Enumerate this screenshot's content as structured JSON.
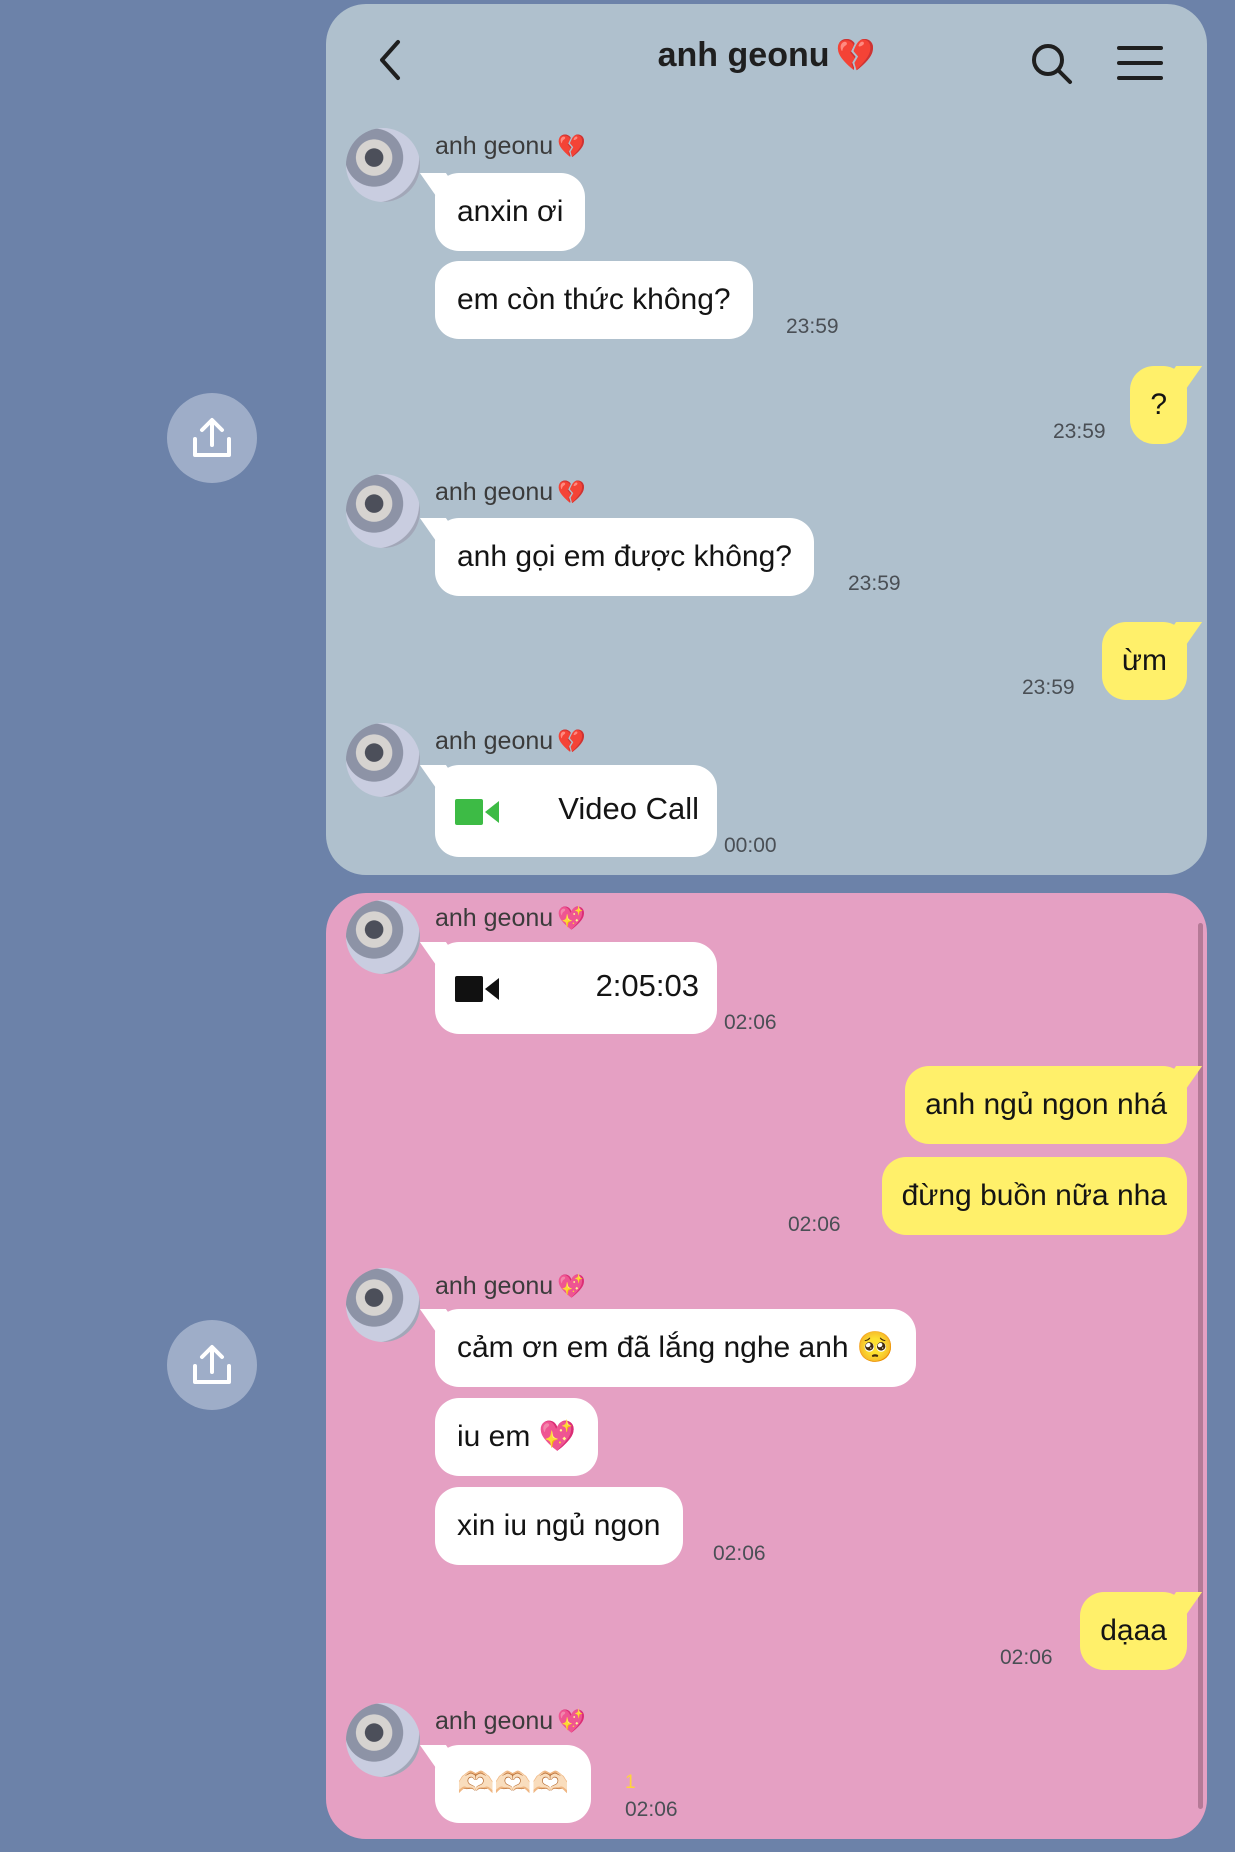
{
  "chat": {
    "title": "anh geonu",
    "title_emoji": "💔",
    "contact_name": "anh geonu",
    "heart_broken": "💔",
    "heart_sparkle": "💖"
  },
  "icons": {
    "back": "chevron-left-icon",
    "search": "search-icon",
    "menu": "hamburger-menu-icon",
    "share": "share-upload-icon",
    "video": "video-camera-icon"
  },
  "colors": {
    "page_bg": "#6c82a9",
    "panel_blue": "#afc0cd",
    "panel_pink": "#e5a0c3",
    "outgoing_bubble": "#fff06a",
    "incoming_bubble": "#ffffff",
    "call_icon_green": "#3dbb45"
  },
  "panel1": {
    "msg1": "anxin ơi",
    "msg2": "em còn thức không?",
    "msg2_time": "23:59",
    "out1": "?",
    "out1_time": "23:59",
    "msg3": "anh gọi em được không?",
    "msg3_time": "23:59",
    "out2": "ừm",
    "out2_time": "23:59",
    "call_label": "Video Call",
    "call_time": "00:00"
  },
  "panel2": {
    "call_duration": "2:05:03",
    "call_time": "02:06",
    "out1": "anh ngủ ngon nhá",
    "out2": "đừng buồn nữa nha",
    "out2_time": "02:06",
    "msg1": "cảm ơn em đã lắng nghe anh 🥺",
    "msg2": "iu em 💖",
    "msg3": "xin iu ngủ ngon",
    "msg3_time": "02:06",
    "out3": "dạaa",
    "out3_time": "02:06",
    "msg4": "🫶🏻🫶🏻🫶🏻",
    "msg4_unread": "1",
    "msg4_time": "02:06"
  }
}
